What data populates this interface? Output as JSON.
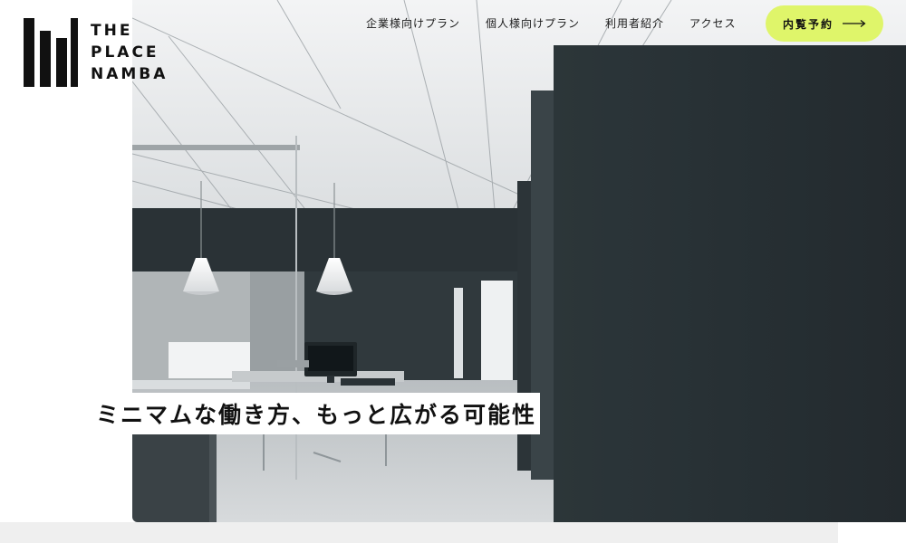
{
  "logo": {
    "lines": [
      "THE",
      "PLACE",
      "NAMBA"
    ]
  },
  "nav": {
    "items": [
      {
        "label": "企業様向けプラン"
      },
      {
        "label": "個人様向けプラン"
      },
      {
        "label": "利用者紹介"
      },
      {
        "label": "アクセス"
      }
    ]
  },
  "cta": {
    "label": "内覧予約",
    "color": "#dff56a",
    "icon": "arrow-right-icon"
  },
  "hero": {
    "tagline": "ミニマムな働き方、もっと広がる可能性"
  },
  "colors": {
    "wall_dark": "#2b3438",
    "ceiling": "#eef0f1",
    "floor": "#c9cdcf"
  }
}
